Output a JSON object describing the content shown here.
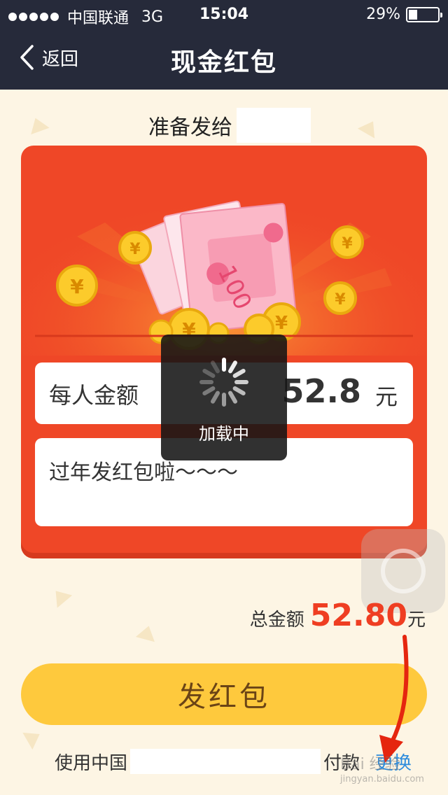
{
  "status_bar": {
    "carrier": "中国联通",
    "network": "3G",
    "time": "15:04",
    "battery": "29%",
    "battery_fraction": 0.29
  },
  "nav": {
    "back_label": "返回",
    "title": "现金红包"
  },
  "recipient": {
    "label": "准备发给"
  },
  "form": {
    "amount_label": "每人金额",
    "amount_value": "52.8",
    "amount_unit": "元",
    "message": "过年发红包啦～～～"
  },
  "loading": {
    "text": "加载中"
  },
  "total": {
    "label": "总金额",
    "value": "52.80",
    "unit": "元"
  },
  "send_button": {
    "label": "发红包"
  },
  "payment": {
    "prefix": "使用中国",
    "suffix": "付款",
    "change_label": "更换"
  },
  "watermark": {
    "text": "Bai 经验",
    "url": "jingyan.baidu.com"
  },
  "colors": {
    "nav_bg": "#262a3a",
    "page_bg": "#fdf5e4",
    "card_red": "#ef4727",
    "button_yellow": "#fec93d",
    "total_red": "#ef3e22",
    "link_blue": "#2d8cdd"
  },
  "icons": {
    "back": "chevron-left-icon",
    "spinner": "loading-spinner-icon",
    "assistive": "assistive-touch-icon",
    "arrow": "red-arrow-annotation"
  }
}
